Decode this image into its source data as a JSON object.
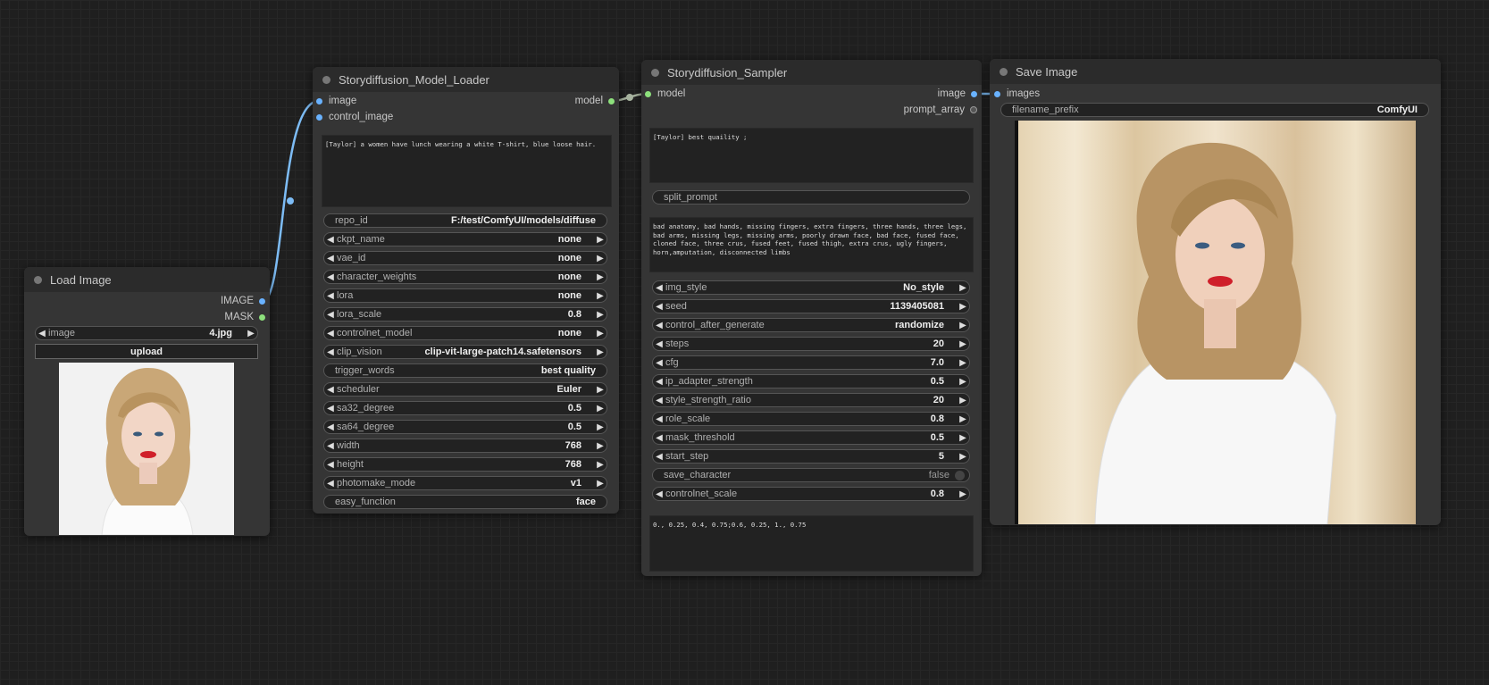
{
  "nodes": {
    "load_image": {
      "title": "Load Image",
      "outputs": [
        "IMAGE",
        "MASK"
      ],
      "image_widget": {
        "label": "image",
        "value": "4.jpg"
      },
      "upload_label": "upload"
    },
    "model_loader": {
      "title": "Storydiffusion_Model_Loader",
      "inputs": [
        "image",
        "control_image"
      ],
      "output": "model",
      "prompt_text": "[Taylor] a women have lunch wearing a white T-shirt, blue loose hair.",
      "widgets": [
        {
          "label": "repo_id",
          "value": "F:/test/ComfyUI/models/diffuse",
          "kind": "text"
        },
        {
          "label": "ckpt_name",
          "value": "none",
          "kind": "combo"
        },
        {
          "label": "vae_id",
          "value": "none",
          "kind": "combo"
        },
        {
          "label": "character_weights",
          "value": "none",
          "kind": "combo"
        },
        {
          "label": "lora",
          "value": "none",
          "kind": "combo"
        },
        {
          "label": "lora_scale",
          "value": "0.8",
          "kind": "combo"
        },
        {
          "label": "controlnet_model",
          "value": "none",
          "kind": "combo"
        },
        {
          "label": "clip_vision",
          "value": "clip-vit-large-patch14.safetensors",
          "kind": "combo"
        },
        {
          "label": "trigger_words",
          "value": "best quality",
          "kind": "text"
        },
        {
          "label": "scheduler",
          "value": "Euler",
          "kind": "combo"
        },
        {
          "label": "sa32_degree",
          "value": "0.5",
          "kind": "combo"
        },
        {
          "label": "sa64_degree",
          "value": "0.5",
          "kind": "combo"
        },
        {
          "label": "width",
          "value": "768",
          "kind": "combo"
        },
        {
          "label": "height",
          "value": "768",
          "kind": "combo"
        },
        {
          "label": "photomake_mode",
          "value": "v1",
          "kind": "combo"
        },
        {
          "label": "easy_function",
          "value": "face",
          "kind": "text"
        }
      ]
    },
    "sampler": {
      "title": "Storydiffusion_Sampler",
      "input": "model",
      "outputs": [
        "image",
        "prompt_array"
      ],
      "prompt_text": "[Taylor] best quaility ;",
      "split_prompt_label": "split_prompt",
      "negative_text": "bad anatomy, bad hands, missing fingers, extra fingers, three hands, three legs, bad arms, missing legs, missing arms, poorly drawn face, bad face, fused face, cloned face, three crus, fused feet, fused thigh, extra crus, ugly fingers, horn,amputation, disconnected limbs",
      "widgets": [
        {
          "label": "img_style",
          "value": "No_style",
          "kind": "combo"
        },
        {
          "label": "seed",
          "value": "1139405081",
          "kind": "combo"
        },
        {
          "label": "control_after_generate",
          "value": "randomize",
          "kind": "combo"
        },
        {
          "label": "steps",
          "value": "20",
          "kind": "combo"
        },
        {
          "label": "cfg",
          "value": "7.0",
          "kind": "combo"
        },
        {
          "label": "ip_adapter_strength",
          "value": "0.5",
          "kind": "combo"
        },
        {
          "label": "style_strength_ratio",
          "value": "20",
          "kind": "combo"
        },
        {
          "label": "role_scale",
          "value": "0.8",
          "kind": "combo"
        },
        {
          "label": "mask_threshold",
          "value": "0.5",
          "kind": "combo"
        },
        {
          "label": "start_step",
          "value": "5",
          "kind": "combo"
        },
        {
          "label": "save_character",
          "value": "false",
          "kind": "toggle"
        },
        {
          "label": "controlnet_scale",
          "value": "0.8",
          "kind": "combo"
        }
      ],
      "bottom_text": "0., 0.25, 0.4, 0.75;0.6, 0.25, 1., 0.75"
    },
    "save_image": {
      "title": "Save Image",
      "input": "images",
      "filename_prefix": {
        "label": "filename_prefix",
        "value": "ComfyUI"
      }
    }
  },
  "colors": {
    "background": "#1f1f1f",
    "node_body": "#353535",
    "node_title": "#2b2b2b",
    "image_slot": "#69b2ff",
    "model_slot": "#8de07c",
    "link_image": "#7dbcf5",
    "link_model": "#a8b4a0"
  }
}
